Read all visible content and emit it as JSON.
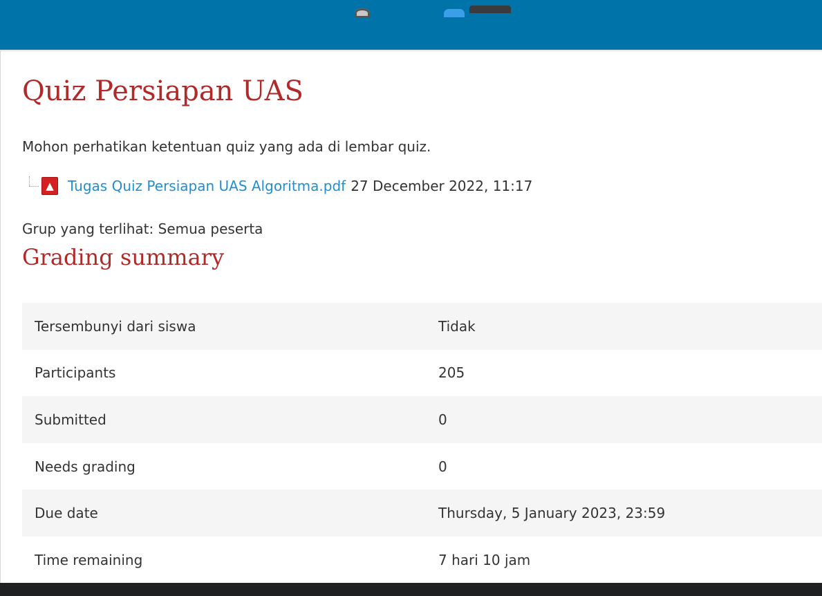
{
  "header": {
    "color": "#0073a8"
  },
  "page": {
    "title": "Quiz Persiapan UAS",
    "intro": "Mohon perhatikan ketentuan quiz yang ada di lembar quiz.",
    "attachment": {
      "icon": "pdf-file-icon",
      "filename": "Tugas Quiz Persiapan UAS Algoritma.pdf",
      "date": "27 December 2022, 11:17"
    },
    "group_visibility": "Grup yang terlihat: Semua peserta",
    "accent_color": "#b02a2a",
    "link_color": "#1f8fd0"
  },
  "summary": {
    "heading": "Grading summary",
    "rows": [
      {
        "label": "Tersembunyi dari siswa",
        "value": "Tidak"
      },
      {
        "label": "Participants",
        "value": "205"
      },
      {
        "label": "Submitted",
        "value": "0"
      },
      {
        "label": "Needs grading",
        "value": "0"
      },
      {
        "label": "Due date",
        "value": "Thursday, 5 January 2023, 23:59"
      },
      {
        "label": "Time remaining",
        "value": "7 hari 10 jam"
      }
    ]
  },
  "taskbar": {
    "icons": [
      "user-icon",
      "notification-badge-icon",
      "window-thumbnail-icon"
    ]
  }
}
